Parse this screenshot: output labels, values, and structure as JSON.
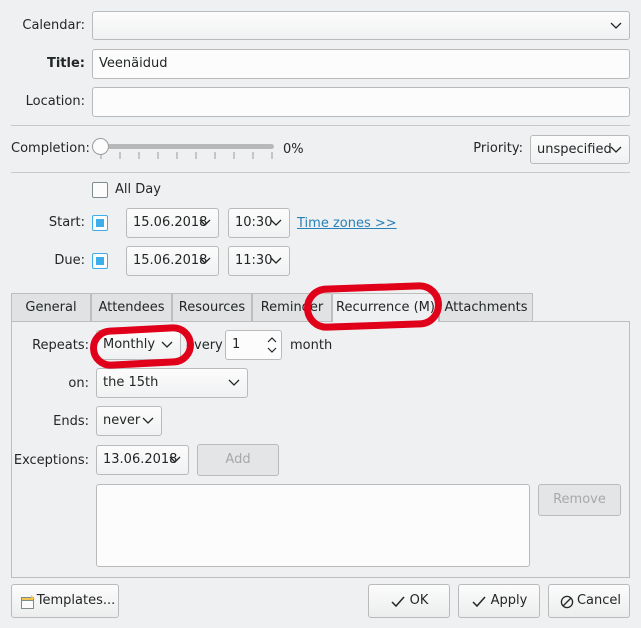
{
  "labels": {
    "calendar": "Calendar:",
    "title": "Title:",
    "location": "Location:",
    "completion": "Completion:",
    "priority": "Priority:",
    "start": "Start:",
    "due": "Due:",
    "repeats": "Repeats:",
    "on": "on:",
    "ends": "Ends:",
    "exceptions": "Exceptions:",
    "every": "every",
    "month": "month"
  },
  "fields": {
    "calendar": "",
    "title": "Veenäidud",
    "location": "",
    "completion_text": "0%",
    "completion_percent": 0,
    "priority": "unspecified",
    "all_day": "All Day",
    "all_day_checked": false,
    "start_checked": true,
    "start_date": "15.06.2018",
    "start_time": "10:30",
    "due_checked": true,
    "due_date": "15.06.2018",
    "due_time": "11:30",
    "time_zones_link": "Time zones >>"
  },
  "tabs": [
    {
      "label": "General",
      "active": false
    },
    {
      "label": "Attendees",
      "active": false
    },
    {
      "label": "Resources",
      "active": false
    },
    {
      "label": "Reminder",
      "active": false
    },
    {
      "label": "Recurrence (M)",
      "active": true
    },
    {
      "label": "Attachments",
      "active": false
    }
  ],
  "recurrence": {
    "repeats": "Monthly",
    "every_value": "1",
    "on": "the 15th",
    "ends": "never",
    "exception_date": "13.06.2018",
    "add_label": "Add",
    "remove_label": "Remove"
  },
  "footer": {
    "templates_label": "Templates...",
    "ok_label": "OK",
    "apply_label": "Apply",
    "cancel_label": "Cancel"
  },
  "icons": {
    "dropdown": "chevron-down-icon",
    "spin": "spin-arrows-icon",
    "templates": "templates-icon",
    "ok": "checkmark-icon",
    "apply": "checkmark-icon",
    "cancel": "cancel-icon"
  },
  "colors": {
    "accent": "#3daee9",
    "link": "#2980b9",
    "annotation": "#e0001a",
    "window_bg": "#eff0f1"
  }
}
